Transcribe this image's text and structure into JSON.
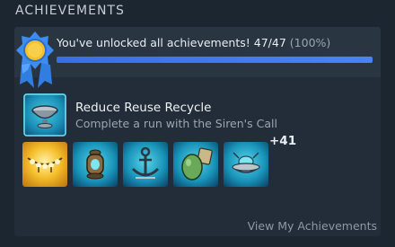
{
  "section": {
    "title": "ACHIEVEMENTS"
  },
  "summary": {
    "text": "You've unlocked all achievements! 47/47",
    "percent_text": "(100%)",
    "progress": 1.0
  },
  "featured": {
    "name": "Reduce Reuse Recycle",
    "description": "Complete a run with the Siren's Call"
  },
  "achievement_icons": [
    "golden-garland-icon",
    "lantern-icon",
    "anchor-icon",
    "egg-scroll-icon",
    "bird-bowl-icon"
  ],
  "more": {
    "label": "+41"
  },
  "footer": {
    "view_label": "View My Achievements"
  },
  "colors": {
    "accent_blue": "#4c82f7",
    "gold": "#f2b21c",
    "teal_tile": "#1fa6c4"
  }
}
